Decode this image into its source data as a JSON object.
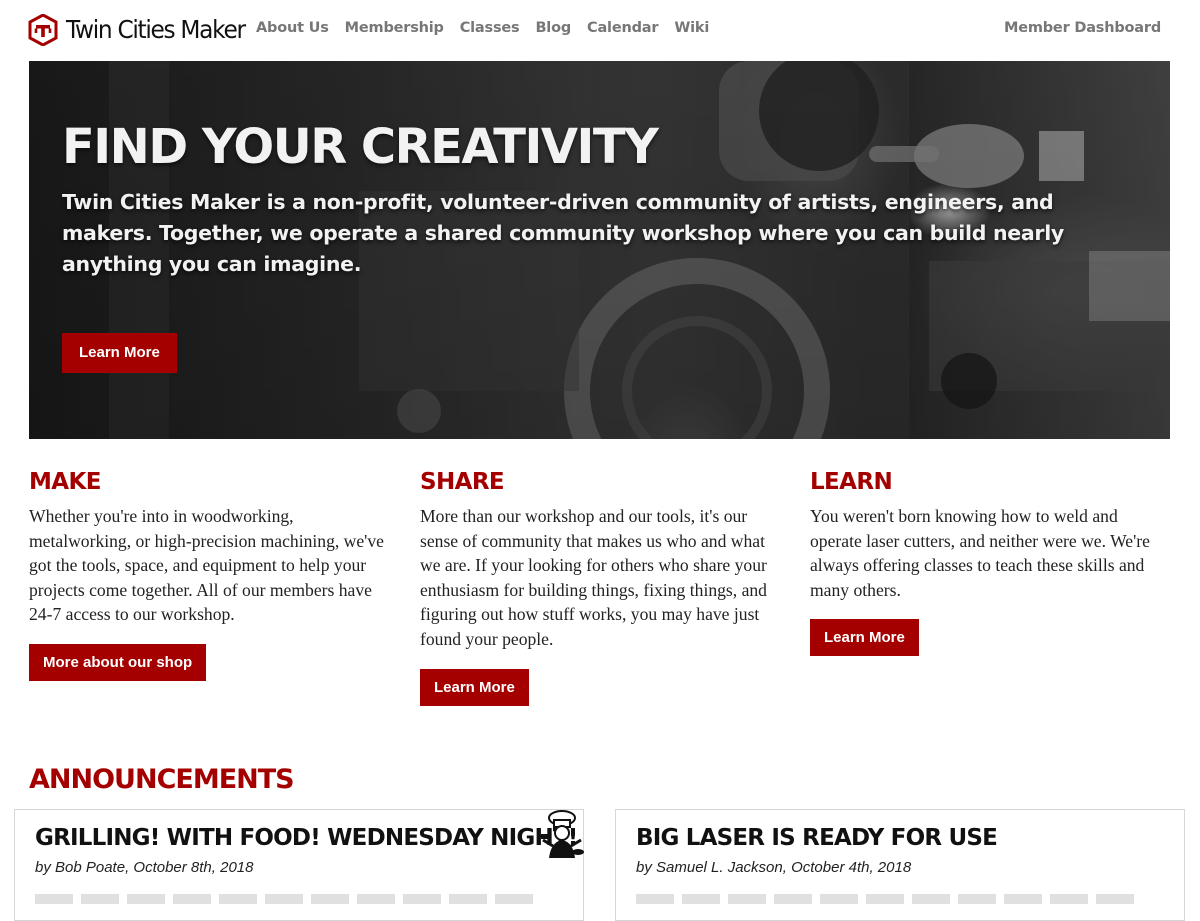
{
  "nav": {
    "brand_name": "Twin Cities Maker",
    "links": [
      "About Us",
      "Membership",
      "Classes",
      "Blog",
      "Calendar",
      "Wiki"
    ],
    "right_link": "Member Dashboard"
  },
  "hero": {
    "title": "FIND YOUR CREATIVITY",
    "text": "Twin Cities Maker is a non-profit, volunteer-driven community of artists, engineers, and makers. Together, we operate a shared community workshop where you can build nearly anything you can imagine.",
    "button": "Learn More"
  },
  "features": [
    {
      "heading": "MAKE",
      "text": "Whether you're into in woodworking, metalworking, or high-precision machining, we've got the tools, space, and equipment to help your projects come together. All of our members have 24-7 access to our workshop.",
      "button": "More about our shop"
    },
    {
      "heading": "SHARE",
      "text": "More than our workshop and our tools, it's our sense of community that makes us who and what we are. If your looking for others who share your enthusiasm for building things, fixing things, and figuring out how stuff works, you may have just found your people.",
      "button": "Learn More"
    },
    {
      "heading": "LEARN",
      "text": "You weren't born knowing how to weld and operate laser cutters, and neither were we. We're always offering classes to teach these skills and many others.",
      "button": "Learn More"
    }
  ],
  "announcements": {
    "heading": "ANNOUNCEMENTS",
    "posts": [
      {
        "title": "GRILLING! WITH FOOD! WEDNESDAY NIGHT!",
        "byline": "by Bob Poate, October 8th, 2018"
      },
      {
        "title": "BIG LASER IS READY FOR USE",
        "byline": "by Samuel L. Jackson, October 4th, 2018"
      }
    ]
  },
  "colors": {
    "accent": "#a50000",
    "nav_text": "#777777",
    "text": "#222222"
  },
  "icons": {
    "brand_logo": "twin-cities-maker-logo-icon",
    "announcement_thumb": "chef-illustration-icon"
  }
}
